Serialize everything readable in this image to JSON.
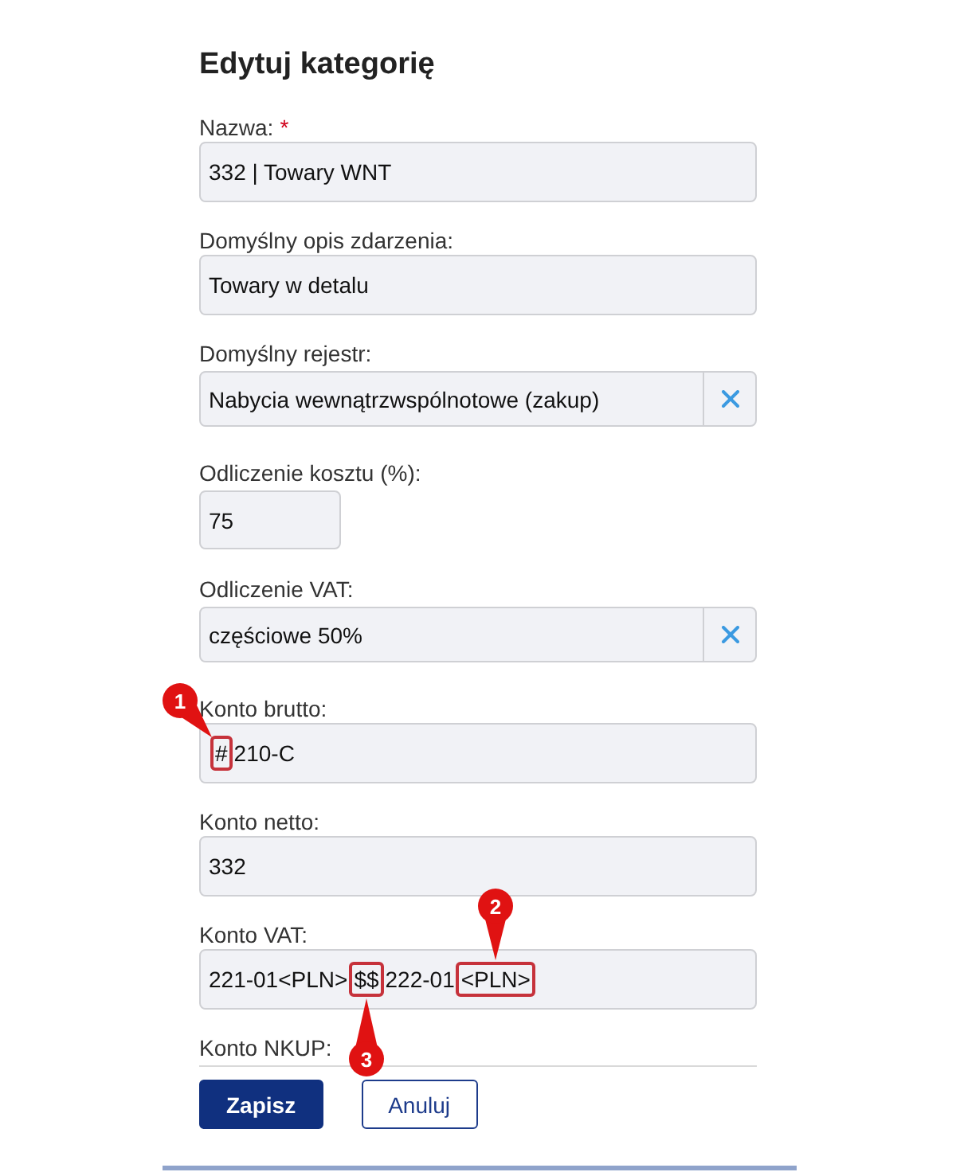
{
  "dialog": {
    "title": "Edytuj kategorię"
  },
  "fields": [
    {
      "label": "Nazwa:",
      "required_mark": "*",
      "kind": "text",
      "value": "332 | Towary WNT"
    },
    {
      "label": "Domyślny opis zdarzenia:",
      "kind": "text",
      "value": "Towary w detalu"
    },
    {
      "label": "Domyślny rejestr:",
      "kind": "select",
      "value": "Nabycia wewnątrzwspólnotowe (zakup)"
    },
    {
      "label": "Odliczenie kosztu (%):",
      "kind": "number",
      "value": "75"
    },
    {
      "label": "Odliczenie VAT:",
      "kind": "select",
      "value": "częściowe 50%"
    },
    {
      "label": "Konto brutto:",
      "kind": "text",
      "value_parts": [
        {
          "text": "#",
          "kind": "slanted",
          "callout": "1"
        },
        {
          "text": "210-C",
          "kind": "plain"
        }
      ]
    },
    {
      "label": "Konto netto:",
      "kind": "text",
      "value": "332"
    },
    {
      "label": "Konto VAT:",
      "kind": "text",
      "value_parts": [
        {
          "text": "221-01<PLN>",
          "kind": "plain"
        },
        {
          "text": "$$",
          "kind": "below",
          "callout": "3"
        },
        {
          "text": "222-01",
          "kind": "plain"
        },
        {
          "text": "<PLN>",
          "kind": "above",
          "callout": "2"
        }
      ]
    },
    {
      "label": "Konto NKUP:"
    }
  ],
  "buttons": [
    {
      "label": "Zapisz",
      "kind": "primary"
    },
    {
      "label": "Anuluj",
      "kind": "secondary"
    }
  ]
}
